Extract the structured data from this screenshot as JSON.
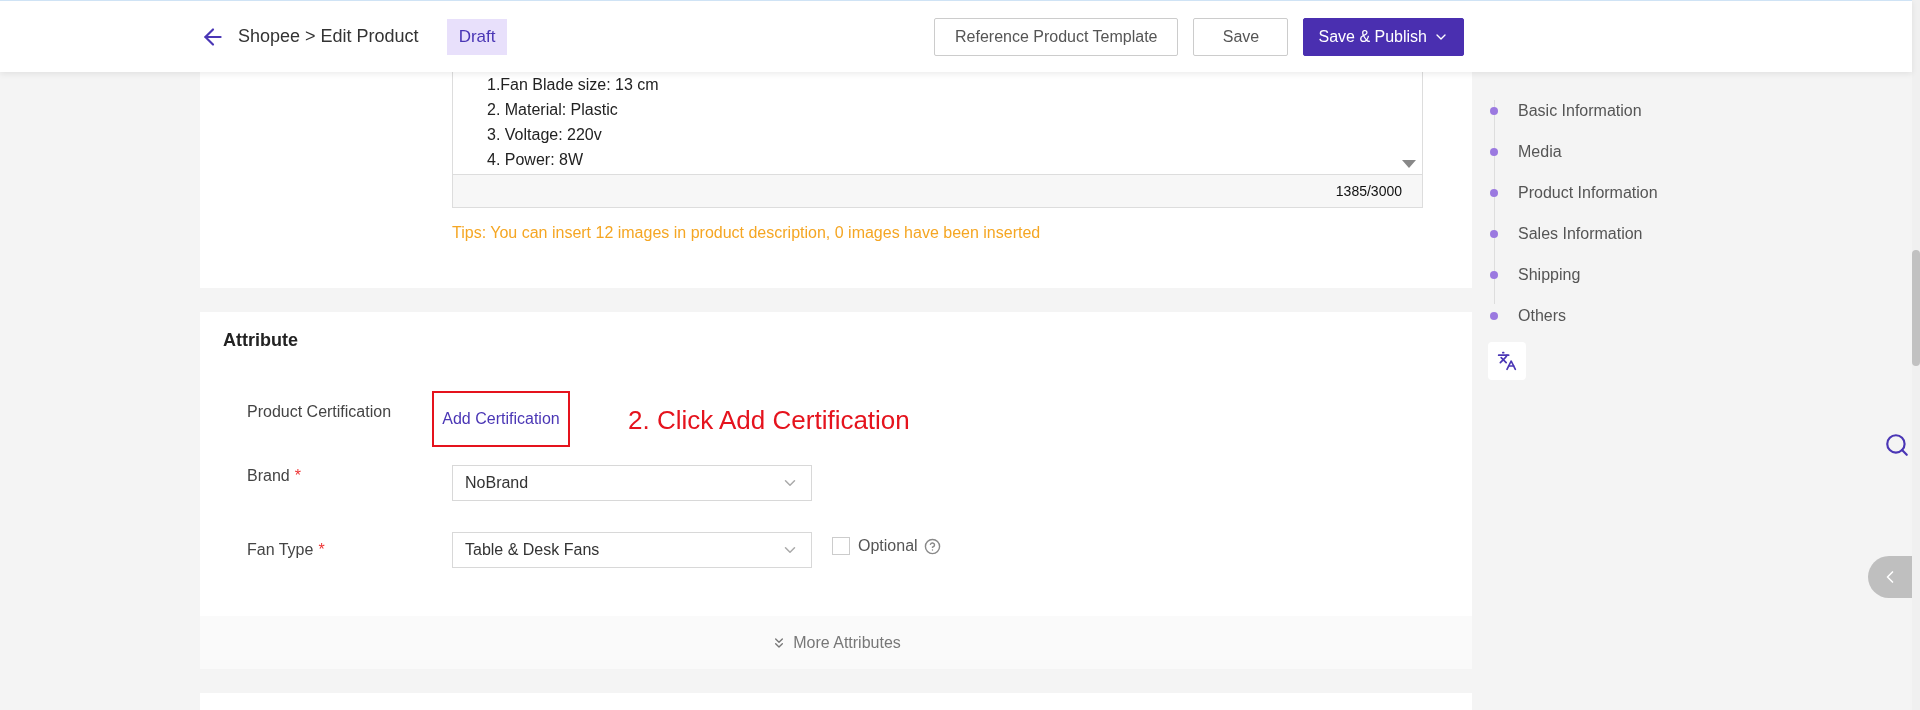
{
  "header": {
    "breadcrumb": "Shopee > Edit Product",
    "status": "Draft",
    "buttons": [
      {
        "label": "Reference Product Template",
        "kind": "outline"
      },
      {
        "label": "Save",
        "kind": "outline"
      },
      {
        "label": "Save & Publish",
        "kind": "primary"
      }
    ]
  },
  "description": {
    "lines": [
      "1.Fan Blade size: 13 cm",
      "2. Material: Plastic",
      "3. Voltage: 220v",
      "4. Power: 8W"
    ],
    "counter": "1385/3000",
    "tips": "Tips: You can insert 12 images in product description, 0 images have been inserted"
  },
  "attribute": {
    "title": "Attribute",
    "certification": {
      "label": "Product Certification",
      "link": "Add Certification",
      "annotation": "2. Click Add Certification"
    },
    "fields": [
      {
        "label": "Brand",
        "required_mark": "*",
        "value": "NoBrand"
      },
      {
        "label": "Fan Type",
        "required_mark": "*",
        "value": "Table & Desk Fans",
        "optional": {
          "label": "Optional",
          "checked": false
        }
      }
    ],
    "more": "More Attributes"
  },
  "nav": {
    "items": [
      {
        "label": "Basic Information"
      },
      {
        "label": "Media"
      },
      {
        "label": "Product Information"
      },
      {
        "label": "Sales Information"
      },
      {
        "label": "Shipping"
      },
      {
        "label": "Others"
      }
    ]
  }
}
